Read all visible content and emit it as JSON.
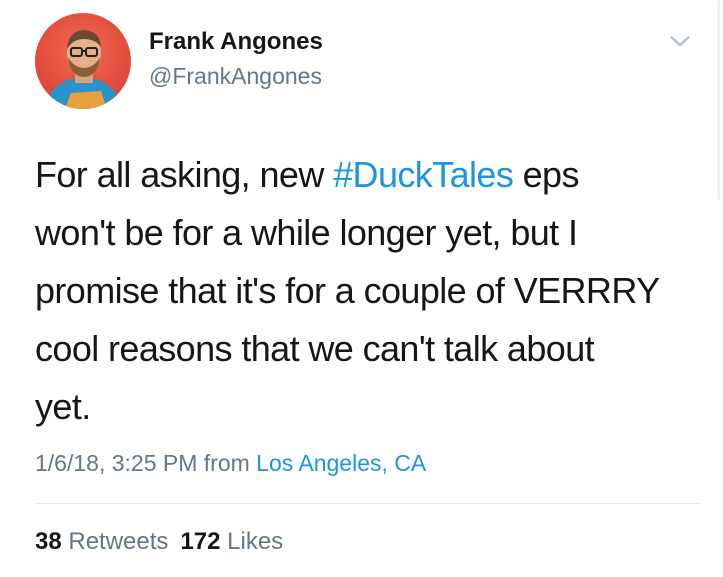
{
  "author": {
    "name": "Frank Angones",
    "handle": "@FrankAngones"
  },
  "tweet": {
    "lines": [
      {
        "before": "For all asking, new ",
        "hashtag": "#DuckTales",
        "after": " eps"
      },
      {
        "text": "won't be for a while longer yet, but I"
      },
      {
        "text": "promise that it's for a couple of VERRRY"
      },
      {
        "text": "cool reasons that we can't talk about"
      },
      {
        "text": "yet."
      }
    ]
  },
  "meta": {
    "timestamp": "1/6/18, 3:25 PM",
    "from_label": "from",
    "location": "Los Angeles, CA"
  },
  "stats": {
    "retweets_count": "38",
    "retweets_label": "Retweets",
    "likes_count": "172",
    "likes_label": "Likes"
  },
  "icons": {
    "menu": "chevron-down-icon"
  },
  "colors": {
    "link": "#1b95e0",
    "secondary_text": "#657786",
    "primary_text": "#14171a",
    "avatar_bg": "#e0483b"
  }
}
